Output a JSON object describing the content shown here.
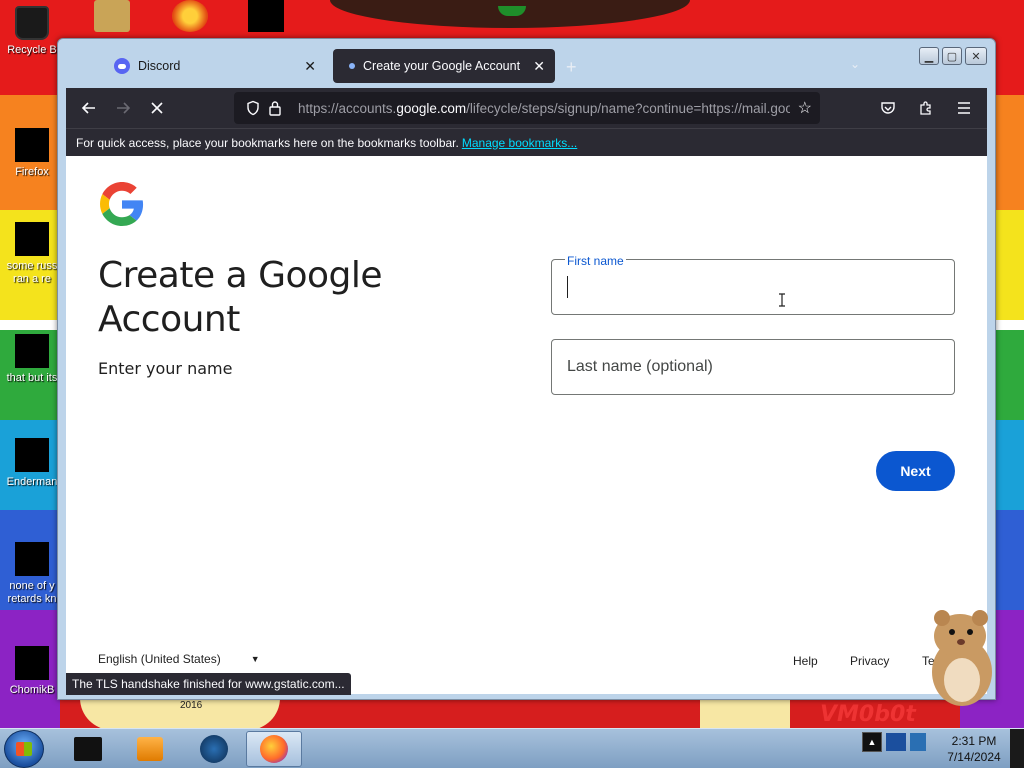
{
  "desktop": {
    "icons": [
      {
        "label": "Recycle B"
      },
      {
        "label": "Firefox"
      },
      {
        "label": "some russ ran a re"
      },
      {
        "label": "that but its"
      },
      {
        "label": "Enderman"
      },
      {
        "label": "none of y retards kn"
      },
      {
        "label": "ChomikB"
      }
    ],
    "wallpaper_year": "2016",
    "wallpaper_watermark": "VM0b0t"
  },
  "browser": {
    "tabs": [
      {
        "title": "Discord",
        "active": false
      },
      {
        "title": "Create your Google Account",
        "active": true
      }
    ],
    "new_tab": "+",
    "url": {
      "prefix": "https://accounts.",
      "domain": "google.com",
      "rest": "/lifecycle/steps/signup/name?continue=https://mail.google.com/mail"
    },
    "bookmarks_text": "For quick access, place your bookmarks here on the bookmarks toolbar.",
    "bookmarks_link": "Manage bookmarks...",
    "status": "The TLS handshake finished for www.gstatic.com..."
  },
  "page": {
    "heading": "Create a Google Account",
    "subheading": "Enter your name",
    "first_name_label": "First name",
    "last_name_placeholder": "Last name (optional)",
    "next_label": "Next",
    "language": "English (United States)",
    "footer": {
      "help": "Help",
      "privacy": "Privacy",
      "terms": "Terms"
    }
  },
  "taskbar": {
    "time": "2:31 PM",
    "date": "7/14/2024"
  },
  "colors": {
    "accent": "#0b57d0",
    "toolbar": "#2b2a33"
  }
}
